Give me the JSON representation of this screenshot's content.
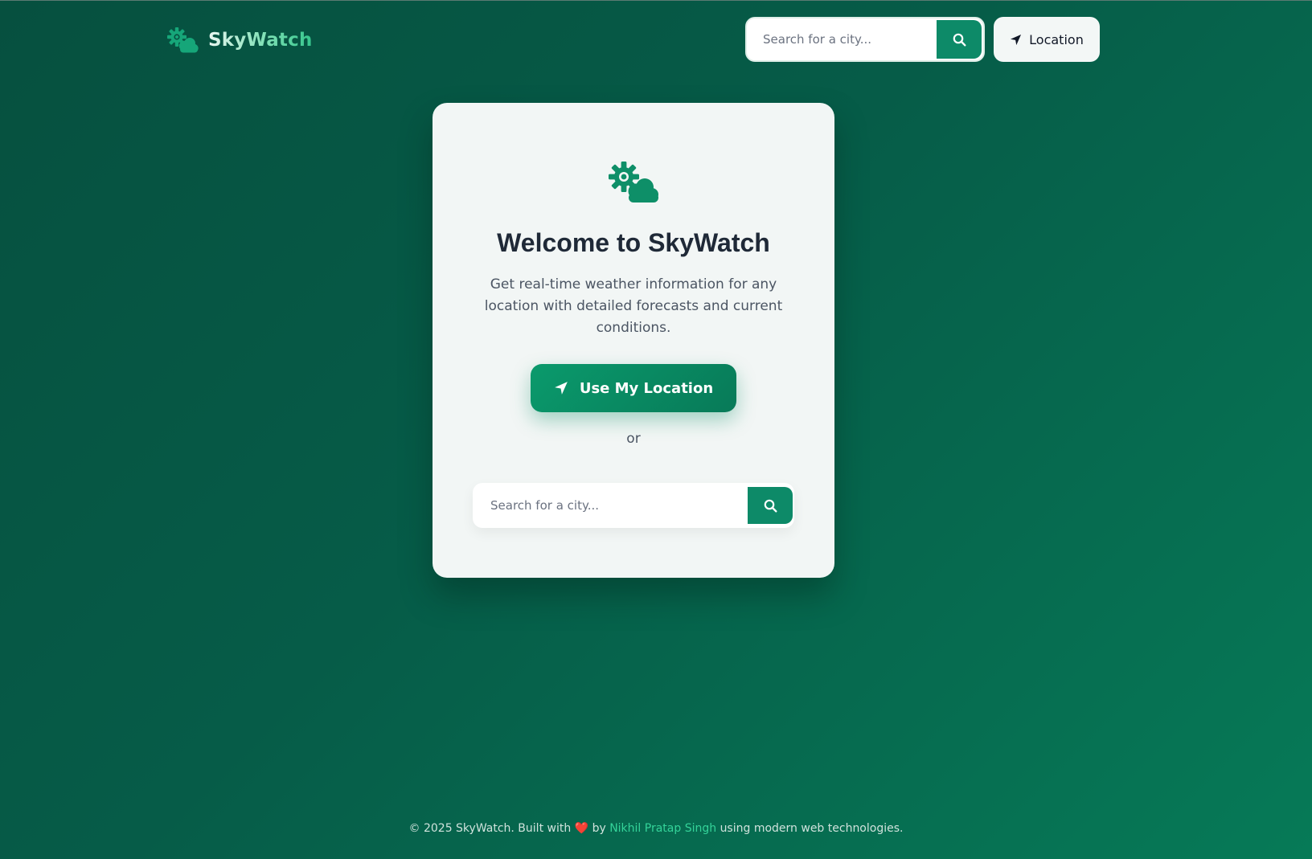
{
  "header": {
    "brand_name": "SkyWatch",
    "search_placeholder": "Search for a city...",
    "location_label": "Location"
  },
  "card": {
    "title": "Welcome to SkyWatch",
    "description": "Get real-time weather information for any location with detailed forecasts and current conditions.",
    "cta_label": "Use My Location",
    "or_text": "or",
    "search_placeholder": "Search for a city..."
  },
  "footer": {
    "prefix": "© 2025 SkyWatch. Built with",
    "heart": "❤️",
    "by": "by",
    "author": "Nikhil Pratap Singh",
    "suffix": "using modern web technologies."
  },
  "icons": {
    "brand": "sun-cloud-icon",
    "search": "search-icon",
    "location": "location-arrow-icon"
  },
  "colors": {
    "accent": "#0d8a68",
    "brand_green": "#34d399",
    "background": "#065c48"
  }
}
